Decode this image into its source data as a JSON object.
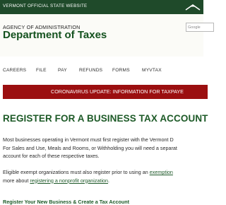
{
  "topbar": {
    "site_label": "VERMONT OFFICIAL STATE WEBSITE",
    "logo_icon": "vermont-mountain-logo-icon"
  },
  "header": {
    "agency": "AGENCY OF ADMINISTRATION",
    "department": "Department of Taxes",
    "search_placeholder": "Google"
  },
  "nav": {
    "items": [
      "CAREERS",
      "FILE",
      "PAY",
      "REFUNDS",
      "FORMS",
      "MYVTAX"
    ]
  },
  "banner": {
    "text": "CORONAVIRUS UPDATE: INFORMATION FOR TAXPAYE"
  },
  "main": {
    "title": "REGISTER FOR A BUSINESS TAX ACCOUNT",
    "para1_line1": "Most businesses operating in Vermont must first register with the Vermont D",
    "para1_line2": "For Sales and Use, Meals and Rooms, or Withholding you will need a separat",
    "para1_line3": "account for each of these respective taxes.",
    "para2_text1": "Eligible exempt organizations must also register prior to using an ",
    "para2_link1": "exemption",
    "para2_text2": "more about ",
    "para2_link2": "registering a nonprofit organization",
    "para2_text3": ".",
    "subheading": "Register Your New Business & Create a Tax Account"
  },
  "colors": {
    "topbar": "#1f4a2a",
    "brand_green": "#14521f",
    "banner_red": "#9b0f10"
  }
}
